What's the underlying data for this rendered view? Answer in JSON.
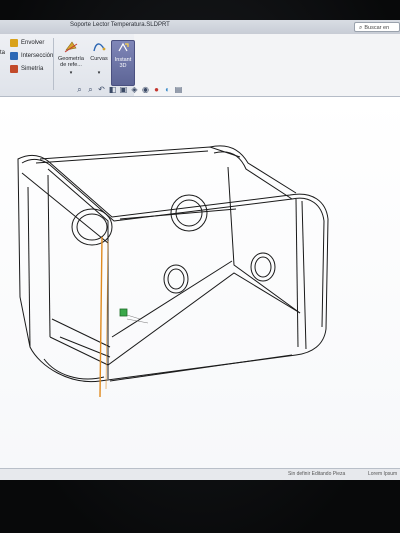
{
  "window": {
    "title": "Soporte Lector Temperatura.SLDPRT",
    "search_placeholder": "Buscar en"
  },
  "ribbon": {
    "left_cut_label": "ta",
    "features": [
      {
        "label": "Envolver",
        "icon": "wrap-icon",
        "color": "#d9a21b"
      },
      {
        "label": "Intersección",
        "icon": "intersect-icon",
        "color": "#2d68b5"
      },
      {
        "label": "Simetría",
        "icon": "mirror-icon",
        "color": "#c24a2a"
      }
    ],
    "reference_geometry": {
      "label_line1": "Geometría",
      "label_line2": "de refe..."
    },
    "curves": {
      "label": "Curvas"
    },
    "instant3d": {
      "label_line1": "Instant",
      "label_line2": "3D"
    }
  },
  "heads_up_toolbar": [
    "zoom-fit-icon",
    "zoom-area-icon",
    "previous-view-icon",
    "section-view-icon",
    "view-orientation-icon",
    "display-style-icon",
    "hide-show-icon",
    "edit-appearance-icon",
    "apply-scene-icon",
    "view-settings-icon"
  ],
  "statusbar": {
    "left_text": "Sin definir   Editando Pieza",
    "right_text": "Lorem Ipsum"
  },
  "colors": {
    "accent_instant3d": "#5d6596",
    "highlight_edge": "#e08a1e",
    "point_marker": "#3aa84a"
  }
}
